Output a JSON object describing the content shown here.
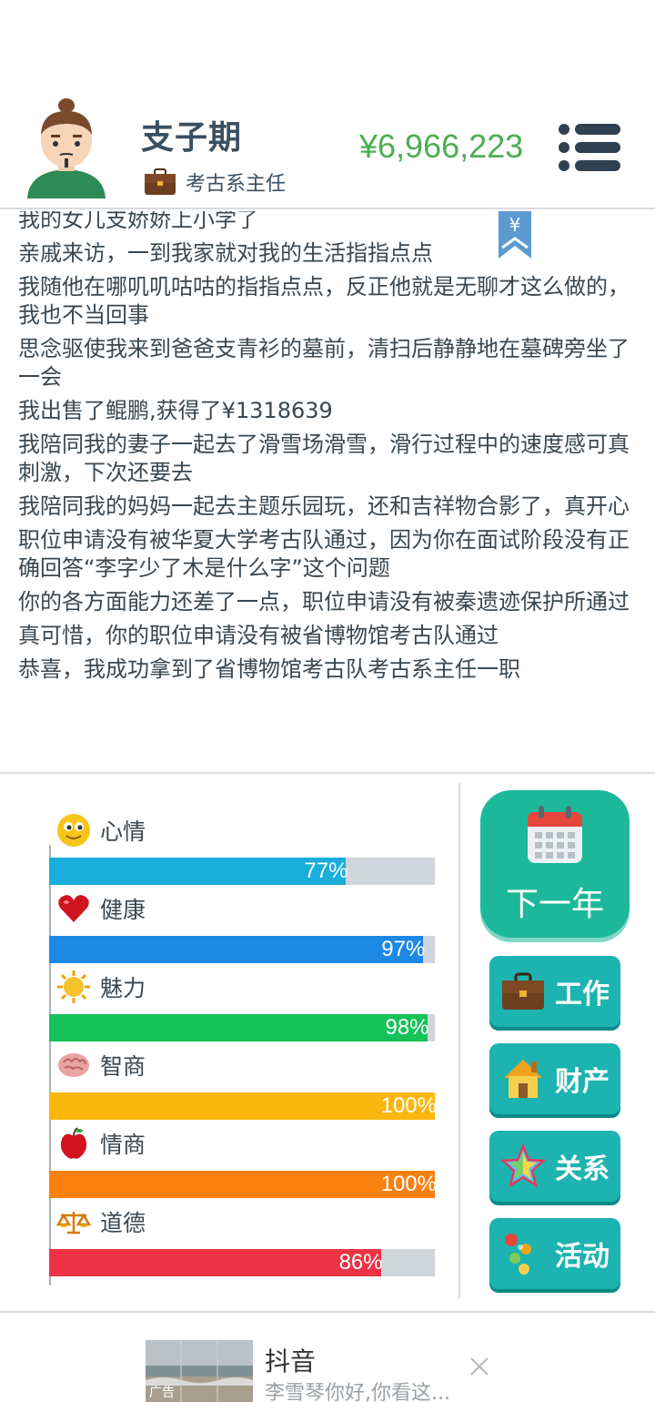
{
  "player": {
    "name": "支子期",
    "job_title": "考古系主任",
    "money": "¥6,966,223"
  },
  "log": [
    "我的女儿支娇娇上小学了",
    "亲戚来访，一到我家就对我的生活指指点点",
    "我随他在哪叽叽咕咕的指指点点，反正他就是无聊才这么做的，我也不当回事",
    "思念驱使我来到爸爸支青衫的墓前，清扫后静静地在墓碑旁坐了一会",
    "我出售了鲲鹏,获得了¥1318639",
    "我陪同我的妻子一起去了滑雪场滑雪，滑行过程中的速度感可真刺激，下次还要去",
    "我陪同我的妈妈一起去主题乐园玩，还和吉祥物合影了，真开心",
    "职位申请没有被华夏大学考古队通过，因为你在面试阶段没有正确回答“李字少了木是什么字”这个问题",
    "你的各方面能力还差了一点，职位申请没有被秦遗迹保护所通过",
    "真可惜，你的职位申请没有被省博物馆考古队通过",
    "恭喜，我成功拿到了省博物馆考古队考古系主任一职"
  ],
  "bookmark_symbol": "¥",
  "stats": [
    {
      "key": "mood",
      "label": "心情",
      "value": 77,
      "display": "77%",
      "color": "#1aaedb",
      "icon": "smiley-icon"
    },
    {
      "key": "health",
      "label": "健康",
      "value": 97,
      "display": "97%",
      "color": "#1e88e5",
      "icon": "heart-icon"
    },
    {
      "key": "charm",
      "label": "魅力",
      "value": 98,
      "display": "98%",
      "color": "#17c15a",
      "icon": "sun-icon"
    },
    {
      "key": "iq",
      "label": "智商",
      "value": 100,
      "display": "100%",
      "color": "#fbb710",
      "icon": "brain-icon"
    },
    {
      "key": "eq",
      "label": "情商",
      "value": 100,
      "display": "100%",
      "color": "#fa8110",
      "icon": "apple-icon"
    },
    {
      "key": "morality",
      "label": "道德",
      "value": 86,
      "display": "86%",
      "color": "#ec3345",
      "icon": "scales-icon"
    }
  ],
  "actions": {
    "next_year": "下一年",
    "work": "工作",
    "assets": "财产",
    "relations": "关系",
    "activities": "活动"
  },
  "ad": {
    "title": "抖音",
    "description": "李雪琴你好,你看这...",
    "badge": "广告"
  },
  "colors": {
    "money": "#4caf50",
    "next_year_bg": "#1db89a",
    "action_bg": "#1cb3b0",
    "bar_track": "#cfd5da"
  }
}
